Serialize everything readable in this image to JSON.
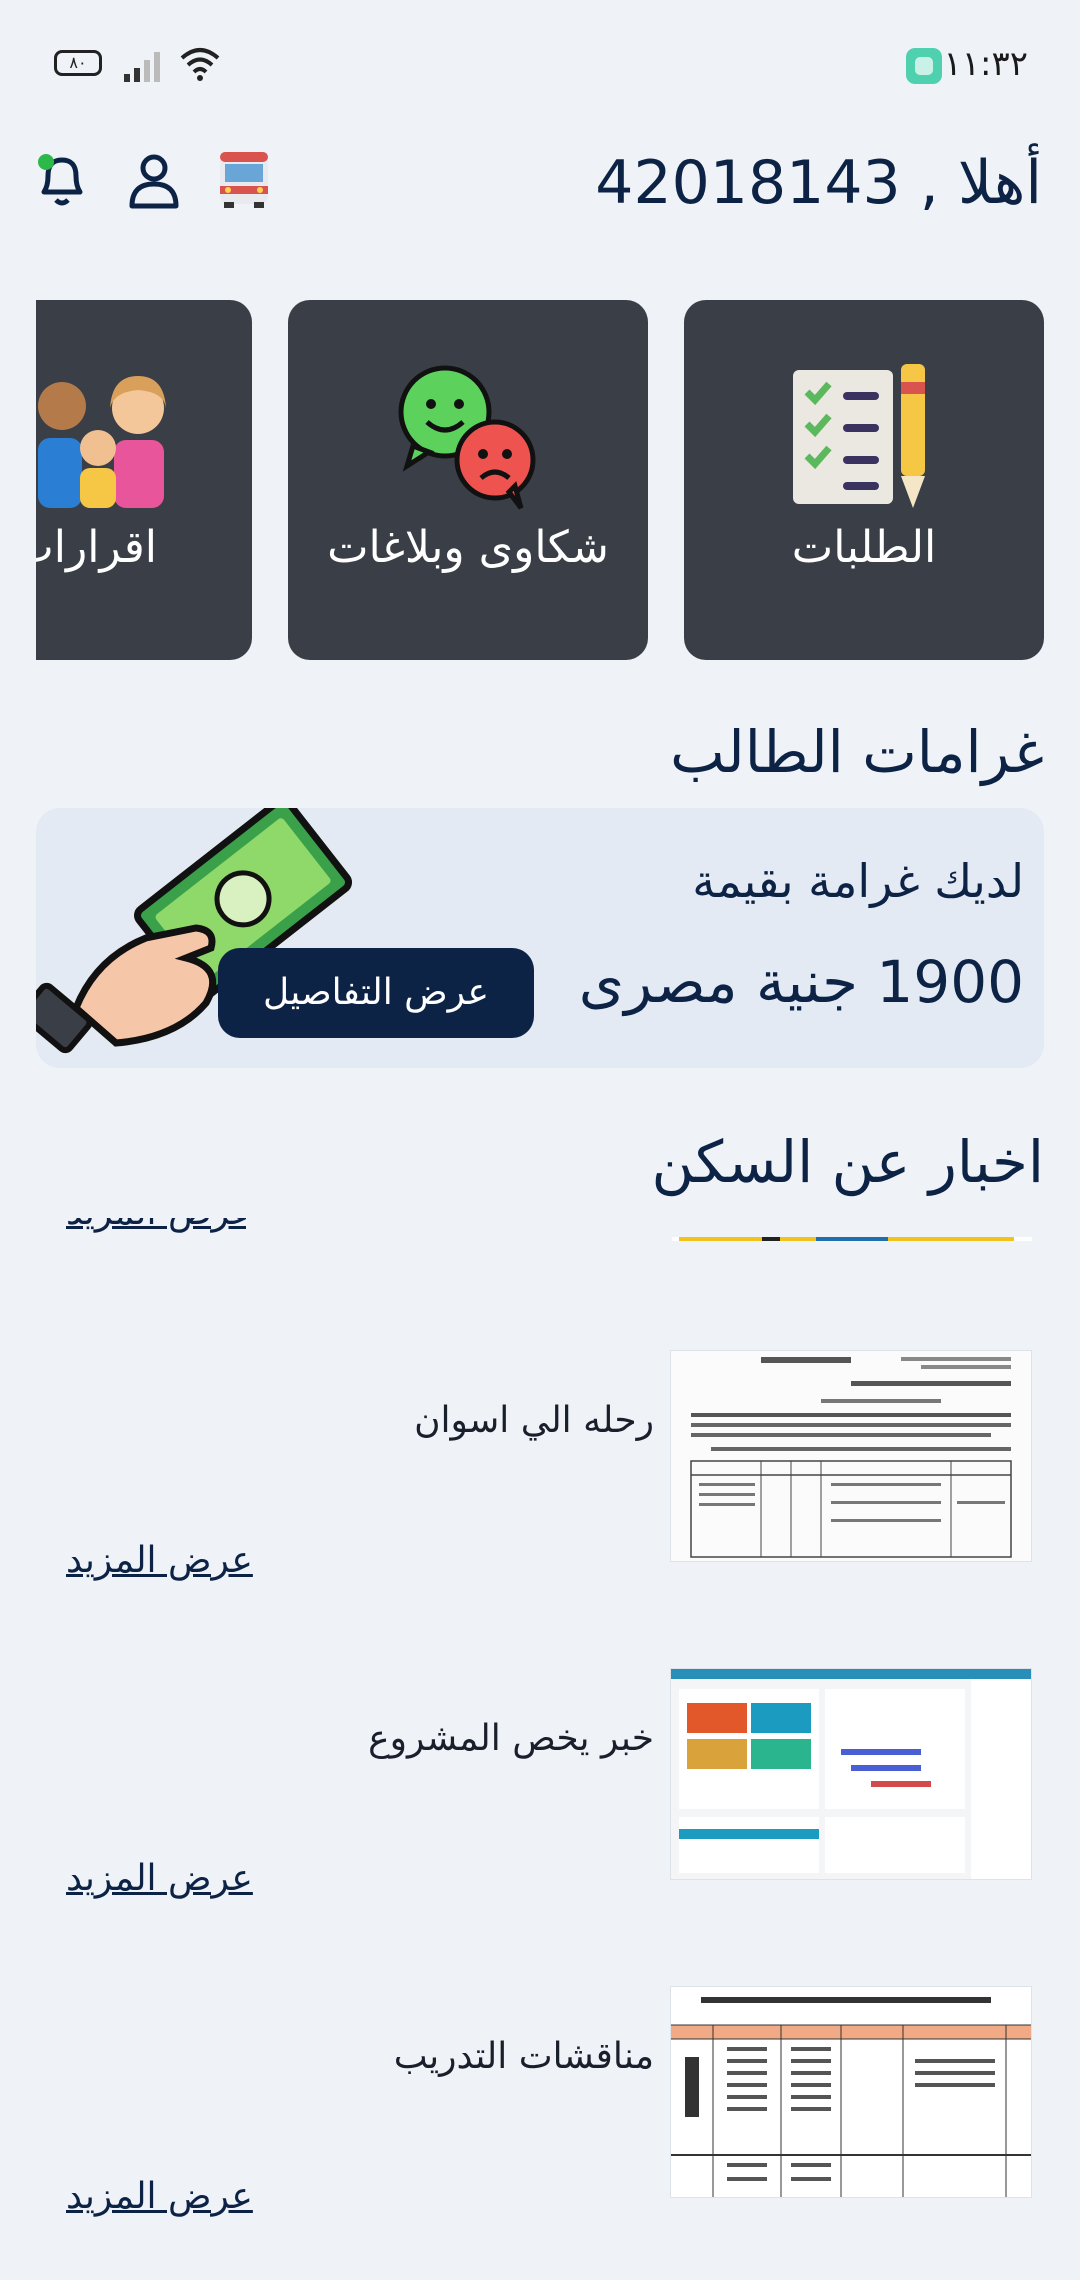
{
  "status_bar": {
    "time": "١١:٣٢",
    "battery": "٨٠"
  },
  "header": {
    "greeting": "أهلا , 42018143"
  },
  "services": [
    {
      "label": "الطلبات",
      "icon": "checklist-pencil-icon"
    },
    {
      "label": "شكاوى وبلاغات",
      "icon": "chat-faces-icon"
    },
    {
      "label": "اقرارات ولي",
      "icon": "family-icon"
    }
  ],
  "fines": {
    "title": "غرامات الطالب",
    "line1": "لديك غرامة بقيمة",
    "amount": "1900 جنية مصرى",
    "button": "عرض التفاصيل"
  },
  "news": {
    "title": "اخبار عن السكن",
    "partial_more": "عرض المزيد",
    "items": [
      {
        "title": "رحله الي اسوان",
        "more": "عرض المزيد",
        "thumb": "document-thumbnail"
      },
      {
        "title": "خبر يخص المشروع",
        "more": "عرض المزيد",
        "thumb": "dashboard-thumbnail"
      },
      {
        "title": "مناقشات التدريب",
        "more": "عرض المزيد",
        "thumb": "table-thumbnail"
      }
    ]
  }
}
